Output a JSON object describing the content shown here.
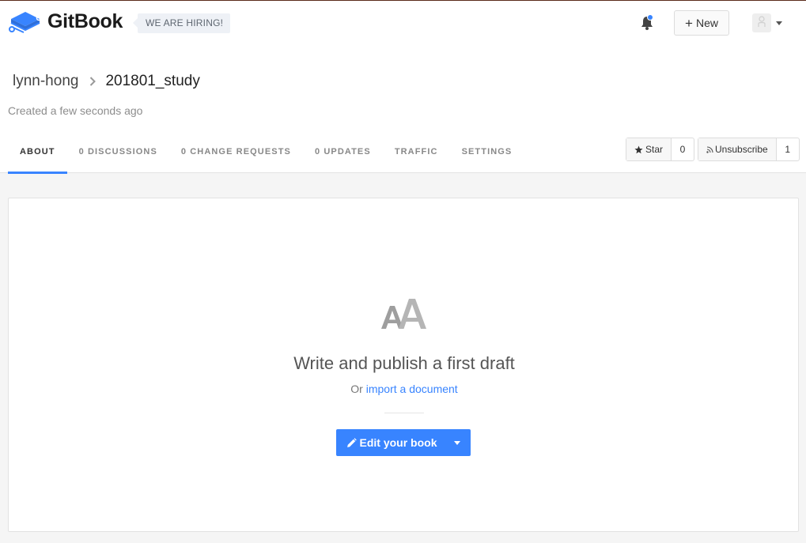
{
  "header": {
    "brand": "GitBook",
    "hiring": "WE ARE HIRING!",
    "new_label": "New",
    "colors": {
      "accent": "#3884ff",
      "notification_dot": "#3884ff"
    },
    "icons": [
      "gitbook-logo-icon",
      "bell-icon",
      "plus-icon",
      "avatar-icon",
      "caret-down-icon"
    ]
  },
  "breadcrumb": {
    "owner": "lynn-hong",
    "book": "201801_study"
  },
  "meta": {
    "created": "Created a few seconds ago"
  },
  "tabs": [
    {
      "label": "ABOUT",
      "active": true
    },
    {
      "label": "0 DISCUSSIONS",
      "active": false
    },
    {
      "label": "0 CHANGE REQUESTS",
      "active": false
    },
    {
      "label": "0 UPDATES",
      "active": false
    },
    {
      "label": "TRAFFIC",
      "active": false
    },
    {
      "label": "SETTINGS",
      "active": false
    }
  ],
  "actions": {
    "star_label": "Star",
    "star_count": "0",
    "unsubscribe_label": "Unsubscribe",
    "unsubscribe_count": "1"
  },
  "empty_state": {
    "icon": "font-size-icon",
    "title": "Write and publish a first draft",
    "import_prefix": "Or",
    "import_link": "import a document",
    "edit_label": "Edit your book"
  }
}
